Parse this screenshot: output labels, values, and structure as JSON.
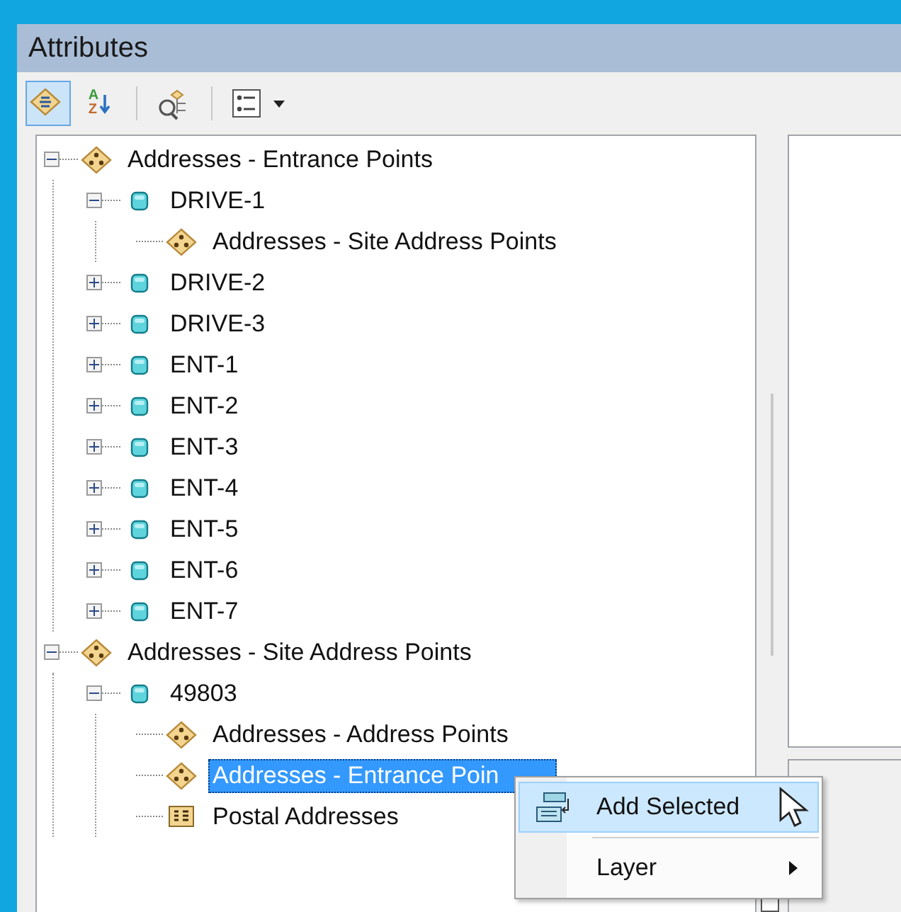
{
  "window": {
    "title": "Attributes"
  },
  "toolbar": [
    {
      "kind": "layer-list",
      "selected": true
    },
    {
      "kind": "sort",
      "selected": false,
      "letters": [
        "A",
        "Z"
      ]
    },
    {
      "kind": "identify",
      "selected": false
    },
    {
      "kind": "options",
      "selected": false
    }
  ],
  "tree": [
    {
      "kind": "layer",
      "label": "Addresses - Entrance Points",
      "expanded": true,
      "selected": false,
      "children": [
        {
          "kind": "record",
          "label": "DRIVE-1",
          "expanded": true,
          "selected": false,
          "children": [
            {
              "kind": "layer",
              "label": "Addresses - Site Address Points",
              "selected": false
            }
          ]
        },
        {
          "kind": "record",
          "label": "DRIVE-2",
          "expanded": false,
          "selected": false
        },
        {
          "kind": "record",
          "label": "DRIVE-3",
          "expanded": false,
          "selected": false
        },
        {
          "kind": "record",
          "label": "ENT-1",
          "expanded": false,
          "selected": false
        },
        {
          "kind": "record",
          "label": "ENT-2",
          "expanded": false,
          "selected": false
        },
        {
          "kind": "record",
          "label": "ENT-3",
          "expanded": false,
          "selected": false
        },
        {
          "kind": "record",
          "label": "ENT-4",
          "expanded": false,
          "selected": false
        },
        {
          "kind": "record",
          "label": "ENT-5",
          "expanded": false,
          "selected": false
        },
        {
          "kind": "record",
          "label": "ENT-6",
          "expanded": false,
          "selected": false
        },
        {
          "kind": "record",
          "label": "ENT-7",
          "expanded": false,
          "selected": false
        }
      ]
    },
    {
      "kind": "layer",
      "label": "Addresses - Site Address Points",
      "expanded": true,
      "selected": false,
      "children": [
        {
          "kind": "record",
          "label": "49803",
          "expanded": true,
          "selected": false,
          "children": [
            {
              "kind": "layer",
              "label": "Addresses - Address Points",
              "selected": false
            },
            {
              "kind": "layer",
              "label": "Addresses - Entrance Poin",
              "selected": true
            },
            {
              "kind": "table",
              "label": "Postal Addresses",
              "selected": false
            }
          ]
        }
      ]
    }
  ],
  "context_menu": [
    {
      "kind": "add",
      "label": "Add Selected",
      "selected": true,
      "submenu": false
    },
    {
      "kind": "plain",
      "label": "Layer",
      "selected": false,
      "submenu": true
    }
  ]
}
